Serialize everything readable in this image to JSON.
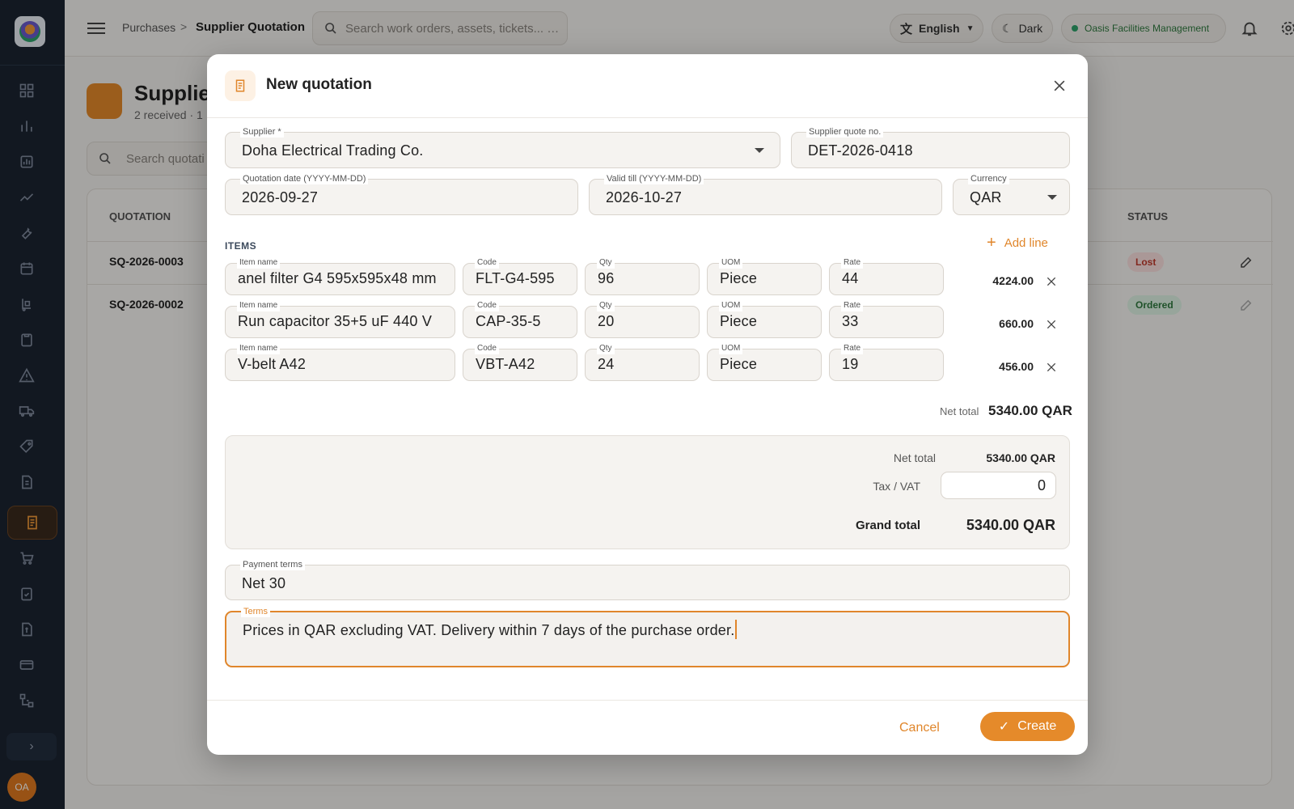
{
  "topbar": {
    "breadcrumb_parent": "Purchases",
    "breadcrumb_sep": ">",
    "breadcrumb_current": "Supplier Quotation",
    "search_placeholder": "Search work orders, assets, tickets... …",
    "language": "English",
    "theme": "Dark",
    "organization": "Oasis Facilities Management",
    "avatar_initials": "OA"
  },
  "sidebar": {
    "icons": [
      "dashboard-icon",
      "bar-chart-icon",
      "report-icon",
      "trend-icon",
      "wrench-icon",
      "calendar-icon",
      "hand-truck-icon",
      "clipboard-icon",
      "warning-icon",
      "truck-icon",
      "tag-icon",
      "invoice-icon",
      "quotation-icon",
      "cart-icon",
      "checklist-icon",
      "billing-icon",
      "payment-icon",
      "hierarchy-icon"
    ],
    "active_icon": "quotation-icon",
    "expand_glyph": "›",
    "avatar_initials": "OA"
  },
  "page": {
    "title": "Supplier",
    "subtitle": "2 received · 1",
    "search_placeholder": "Search quotati",
    "columns": {
      "quotation": "QUOTATION",
      "status": "STATUS"
    },
    "rows": [
      {
        "code": "SQ-2026-0003",
        "status": "Lost"
      },
      {
        "code": "SQ-2026-0002",
        "status": "Ordered"
      }
    ]
  },
  "modal": {
    "title": "New quotation",
    "supplier": {
      "label": "Supplier *",
      "value": "Doha Electrical Trading Co."
    },
    "supplier_quote_no": {
      "label": "Supplier quote no.",
      "value": "DET-2026-0418"
    },
    "quotation_date": {
      "label": "Quotation date (YYYY-MM-DD)",
      "value": "2026-09-27"
    },
    "valid_till": {
      "label": "Valid till (YYYY-MM-DD)",
      "value": "2026-10-27"
    },
    "currency": {
      "label": "Currency",
      "value": "QAR"
    },
    "items_label": "ITEMS",
    "add_line": "Add line",
    "item_labels": {
      "name": "Item name",
      "code": "Code",
      "qty": "Qty",
      "uom": "UOM",
      "rate": "Rate"
    },
    "items": [
      {
        "name": "anel filter G4 595x595x48 mm",
        "code": "FLT-G4-595",
        "qty": "96",
        "uom": "Piece",
        "rate": "44",
        "amount": "4224.00"
      },
      {
        "name": "Run capacitor 35+5 uF 440 V",
        "code": "CAP-35-5",
        "qty": "20",
        "uom": "Piece",
        "rate": "33",
        "amount": "660.00"
      },
      {
        "name": "V-belt A42",
        "code": "VBT-A42",
        "qty": "24",
        "uom": "Piece",
        "rate": "19",
        "amount": "456.00"
      }
    ],
    "net_total_label": "Net total",
    "net_total_value": "5340.00 QAR",
    "totals": {
      "net_label": "Net total",
      "net_value": "5340.00 QAR",
      "tax_label": "Tax / VAT",
      "tax_value": "0",
      "grand_label": "Grand total",
      "grand_value": "5340.00 QAR"
    },
    "payment_terms": {
      "label": "Payment terms",
      "value": "Net 30"
    },
    "terms": {
      "label": "Terms",
      "value": "Prices in QAR excluding VAT. Delivery within 7 days of the purchase order."
    },
    "cancel_label": "Cancel",
    "create_label": "Create"
  },
  "colors": {
    "accent": "#e58a2a",
    "sidebar_bg": "#1b2432",
    "status_lost": "#c0392b",
    "status_ordered": "#2f7a3e"
  }
}
